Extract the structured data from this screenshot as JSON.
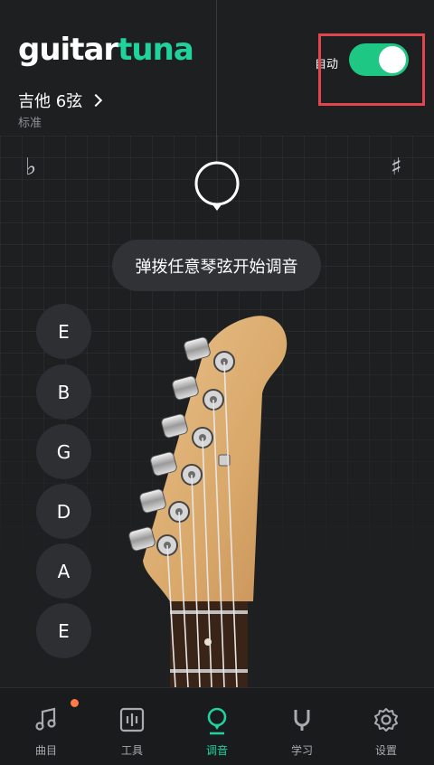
{
  "header": {
    "logo_part1": "guitar",
    "logo_part2": "tuna",
    "instrument": "吉他 6弦",
    "tuning": "标准",
    "auto_label": "自动",
    "auto_enabled": true
  },
  "tuner": {
    "flat_symbol": "♭",
    "sharp_symbol": "♯",
    "hint": "弹拨任意琴弦开始调音"
  },
  "strings": [
    "E",
    "B",
    "G",
    "D",
    "A",
    "E"
  ],
  "nav": {
    "items": [
      {
        "label": "曲目",
        "icon": "music-note-icon"
      },
      {
        "label": "工具",
        "icon": "tools-icon"
      },
      {
        "label": "调音",
        "icon": "tuner-pick-icon"
      },
      {
        "label": "学习",
        "icon": "learn-magnet-icon"
      },
      {
        "label": "设置",
        "icon": "gear-icon"
      }
    ],
    "active_index": 2
  },
  "colors": {
    "accent": "#20d39b",
    "toggle_on": "#1fc784",
    "highlight": "#e2454e",
    "badge": "#ff7a45"
  }
}
